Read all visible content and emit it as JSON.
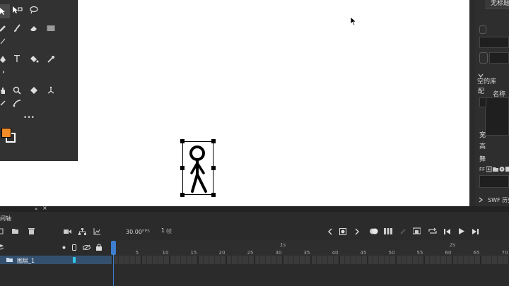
{
  "app": {
    "document_tab": "无标题",
    "accent_color": "#3d7ecf",
    "fill_color": "#f28c28",
    "stroke_color": "#ffffff"
  },
  "tools": {
    "text_tool_label": "T",
    "more_label": "•••",
    "icons": [
      "selection-icon",
      "subselection-icon",
      "lasso-icon",
      "pencil-icon",
      "brush-icon",
      "eraser-icon",
      "rectangle-icon",
      "pen-icon",
      "text-icon",
      "paint-bucket-icon",
      "eyedropper-icon",
      "hand-icon",
      "zoom-icon",
      "asset-warp-icon",
      "bone-icon",
      "camera-icon",
      "width-icon"
    ]
  },
  "properties": {
    "library_tab": "空的库",
    "name_header": "名称",
    "config_label": "配",
    "width_label": "宽",
    "height_label": "高",
    "stage_label": "舞",
    "ff_label": "FF",
    "swf_history": "SWF 历史"
  },
  "timeline": {
    "title": "时间轴",
    "fps": "30.00",
    "fps_unit": "FPS",
    "current_frame": "1",
    "frame_unit": "帧",
    "layer_name": "图层_1",
    "seconds": [
      "1s",
      "2s"
    ],
    "ruler": [
      "5",
      "10",
      "15",
      "20",
      "25",
      "30",
      "35",
      "40",
      "45",
      "50",
      "55",
      "60",
      "65",
      "70"
    ]
  }
}
